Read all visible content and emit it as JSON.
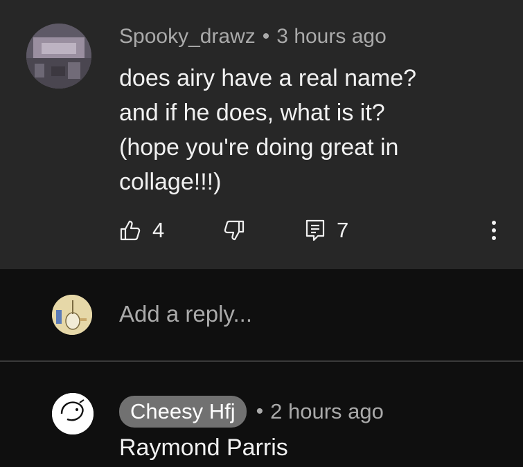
{
  "comment": {
    "author": "Spooky_drawz",
    "separator": "•",
    "time": "3 hours ago",
    "body_lines": [
      "does airy have a real name?",
      "and if he does, what is it?",
      "(hope you're doing great in",
      "collage!!!)"
    ],
    "like_count": "4",
    "reply_count": "7",
    "icons": {
      "like": "thumbs-up-icon",
      "dislike": "thumbs-down-icon",
      "replies": "reply-icon",
      "more": "more-vert-icon"
    }
  },
  "reply_box": {
    "placeholder": "Add a reply..."
  },
  "reply": {
    "author": "Cheesy Hfj",
    "separator": "•",
    "time": "2 hours ago",
    "body": "Raymond Parris"
  },
  "colors": {
    "card_bg": "#272727",
    "page_bg": "#0f0f0f",
    "secondary_text": "#aaaaaa",
    "primary_text": "#f1f1f1",
    "author_chip": "#717171"
  }
}
